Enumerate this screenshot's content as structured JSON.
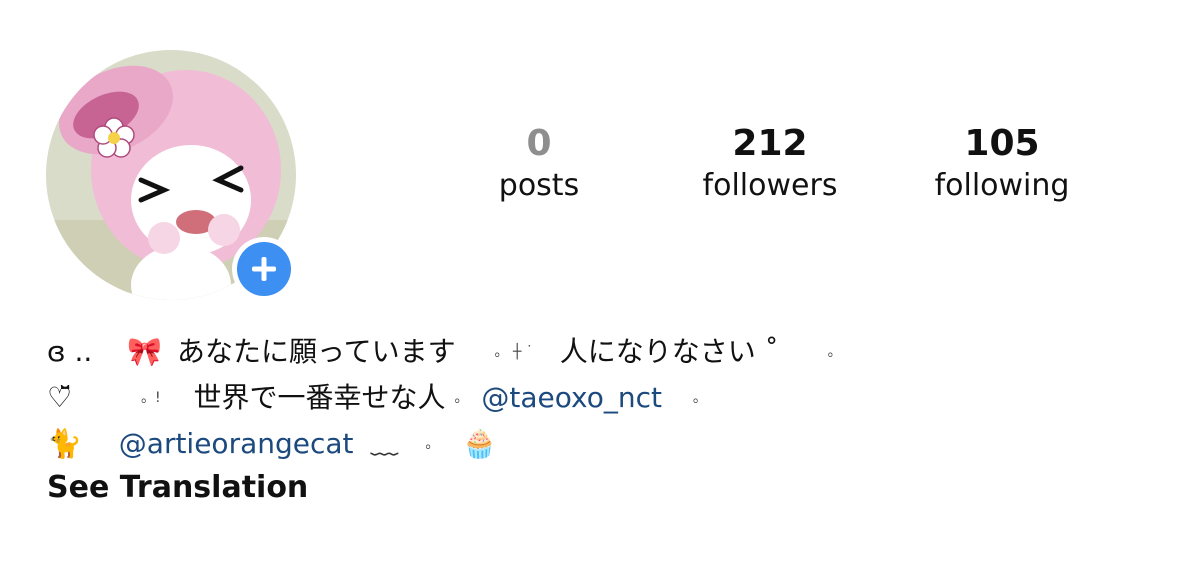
{
  "profile": {
    "avatar_alt": "profile-picture",
    "add_story_symbol": "+"
  },
  "stats": {
    "posts": {
      "count": "0",
      "label": "posts"
    },
    "followers": {
      "count": "212",
      "label": "followers"
    },
    "following": {
      "count": "105",
      "label": "following"
    }
  },
  "bio": {
    "line1": {
      "lead": "ɞ ..",
      "bow_emoji": "🎀",
      "text_a": "あなたに願っています",
      "dots": "。 ┼  ˙",
      "text_b": "人になりなさい ˚",
      "tail": "。"
    },
    "line2": {
      "heart": "♡̆̈",
      "dots": "。!",
      "text": "世界で一番幸せな人",
      "sep": "。",
      "mention": "@taeoxo_nct",
      "tail": "。"
    },
    "line3": {
      "cat_emoji": "🐈",
      "mention": "@artieorangecat",
      "wave": "﹏",
      "dot": "。",
      "cupcake_emoji": "🧁"
    },
    "see_translation": "See Translation"
  },
  "colors": {
    "mention": "#1d4a7e",
    "add_button": "#3d8ff2",
    "posts_zero": "#8e8e8e"
  }
}
